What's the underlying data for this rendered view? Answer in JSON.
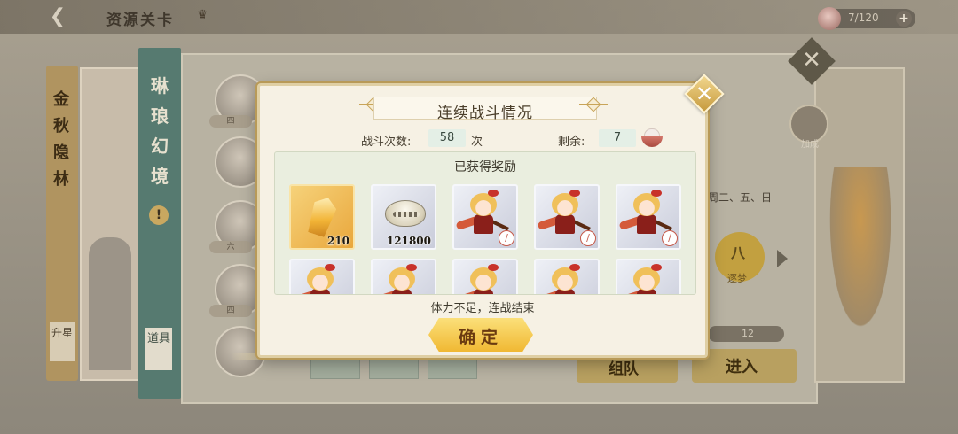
{
  "header": {
    "title": "资源关卡",
    "stamina": "7/120",
    "plus_label": "+"
  },
  "background": {
    "left_stage_name": "金秋隐林",
    "left_stage_button": "升星",
    "teal_stage_name": "琳琅幻境",
    "teal_stage_button": "道具",
    "avatar_labels": [
      "四",
      "",
      "六",
      "四"
    ],
    "schedule": "周二、五、日",
    "difficulty_number": "八",
    "difficulty_label": "逐梦",
    "level_value": "12",
    "badge_label": "加成",
    "team_button": "组队",
    "enter_button": "进入"
  },
  "modal": {
    "title": "连续战斗情况",
    "battles_label": "战斗次数:",
    "battles_value": "58",
    "battles_unit": "次",
    "remaining_label": "剩余:",
    "remaining_value": "7",
    "remaining_icon": "rice-bowl-icon",
    "rewards_heading": "已获得奖励",
    "rewards": [
      {
        "type": "gold-crystal",
        "count": "210"
      },
      {
        "type": "silver-shell",
        "count": "121800"
      },
      {
        "type": "chibi-shikigami",
        "count": ""
      },
      {
        "type": "chibi-shikigami",
        "count": ""
      },
      {
        "type": "chibi-shikigami",
        "count": ""
      },
      {
        "type": "chibi-shikigami",
        "count": ""
      },
      {
        "type": "chibi-shikigami",
        "count": ""
      },
      {
        "type": "chibi-shikigami",
        "count": ""
      },
      {
        "type": "chibi-shikigami",
        "count": ""
      },
      {
        "type": "chibi-shikigami",
        "count": ""
      }
    ],
    "status": "体力不足，连战结束",
    "confirm_label": "确定",
    "close_icon": "close-icon"
  }
}
